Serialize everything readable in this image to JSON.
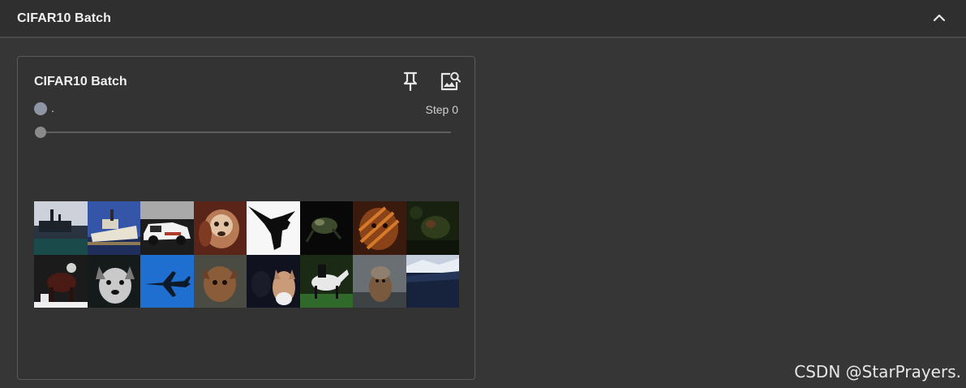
{
  "section": {
    "title": "CIFAR10 Batch",
    "collapse_icon": "chevron-up-icon"
  },
  "card": {
    "title": "CIFAR10 Batch",
    "pin_icon": "pin-icon",
    "fullsize_icon": "image-search-icon",
    "run_label": ".",
    "run_color": "#8e96a3",
    "step_label": "Step 0",
    "step_slider_value": 0
  },
  "image_grid": {
    "rows": 2,
    "cols": 8,
    "tiles": [
      {
        "subject": "ship"
      },
      {
        "subject": "ship"
      },
      {
        "subject": "automobile"
      },
      {
        "subject": "dog"
      },
      {
        "subject": "bird"
      },
      {
        "subject": "frog"
      },
      {
        "subject": "cat"
      },
      {
        "subject": "frog"
      },
      {
        "subject": "horse"
      },
      {
        "subject": "dog"
      },
      {
        "subject": "airplane"
      },
      {
        "subject": "cat"
      },
      {
        "subject": "cat"
      },
      {
        "subject": "horse"
      },
      {
        "subject": "dog"
      },
      {
        "subject": "ship"
      }
    ]
  },
  "watermark": "CSDN @StarPrayers.",
  "colors": {
    "background": "#363636",
    "header": "#2f2f2f",
    "card_border": "#5a5a5a",
    "text": "#f0f0f0"
  }
}
